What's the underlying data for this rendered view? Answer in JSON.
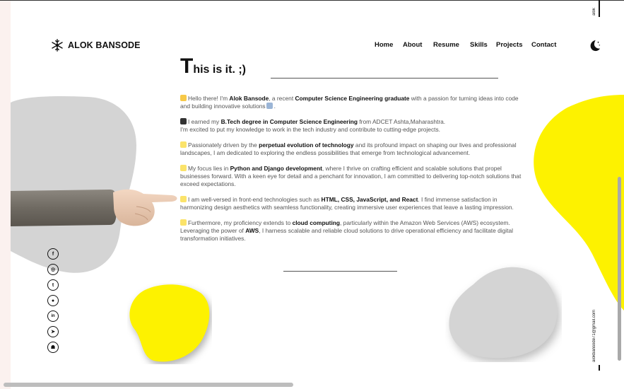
{
  "brand": {
    "name": "ALOK BANSODE",
    "icon": "snowflake-icon"
  },
  "nav": {
    "home": "Home",
    "about": "About",
    "resume": "Resume",
    "skills": "Skills",
    "projects": "Projects",
    "contact": "Contact"
  },
  "theme_toggle_icon": "moon-stars-icon",
  "rail": {
    "email": "aiokbansode71@gmail.com",
    "top_text": "alok"
  },
  "title": {
    "first": "T",
    "rest": "his is it. ;)"
  },
  "paragraphs": {
    "p1": {
      "emoji": "waving-hand",
      "a": "Hello there! I'm ",
      "b1": "Alok Bansode",
      "c": ", a recent ",
      "b2": "Computer Science Engineering graduate",
      "d": " with a passion for turning ideas into code and building innovative solutions"
    },
    "p2": {
      "emoji": "graduation-cap",
      "a": "I earned my ",
      "b1": "B.Tech degree in Computer Science Engineering",
      "c": " from ADCET Ashta,Maharashtra.",
      "d": "I'm excited to put my knowledge to work in the tech industry and contribute to cutting-edge projects."
    },
    "p3": {
      "emoji": "sparkle",
      "a": "Passionately driven by the ",
      "b1": "perpetual evolution of technology",
      "c": " and its profound impact on shaping our lives and professional landscapes, I am dedicated to exploring the endless possibilities that emerge from technological advancement."
    },
    "p4": {
      "emoji": "sparkle",
      "a": "My focus lies in ",
      "b1": "Python and Django development",
      "c": ", where I thrive on crafting efficient and scalable solutions that propel businesses forward. With a keen eye for detail and a penchant for innovation, I am committed to delivering top-notch solutions that exceed expectations."
    },
    "p5": {
      "emoji": "sparkle",
      "a": "I am well-versed in front-end technologies such as ",
      "b1": "HTML, CSS, JavaScript, and React",
      "c": ". I find immense satisfaction in harmonizing design aesthetics with seamless functionality, creating immersive user experiences that leave a lasting impression."
    },
    "p6": {
      "emoji": "sparkle",
      "a": "Furthermore, my proficiency extends to ",
      "b1": "cloud computing",
      "c": ", particularly within the Amazon Web Services (AWS) ecosystem. Leveraging the power of ",
      "b2": "AWS",
      "d": ", I harness scalable and reliable cloud solutions to drive operational efficiency and facilitate digital transformation initiatives."
    }
  },
  "socials": [
    {
      "icon": "facebook-icon",
      "glyph": "f"
    },
    {
      "icon": "instagram-icon",
      "glyph": "◎"
    },
    {
      "icon": "twitter-icon",
      "glyph": "t"
    },
    {
      "icon": "github-icon",
      "glyph": "●"
    },
    {
      "icon": "linkedin-icon",
      "glyph": "in"
    },
    {
      "icon": "telegram-icon",
      "glyph": "➤"
    },
    {
      "icon": "snapchat-icon",
      "glyph": "☗"
    }
  ],
  "colors": {
    "accent_yellow": "#fdf200",
    "blob_gray": "#d4d4d4",
    "text": "#555555"
  }
}
